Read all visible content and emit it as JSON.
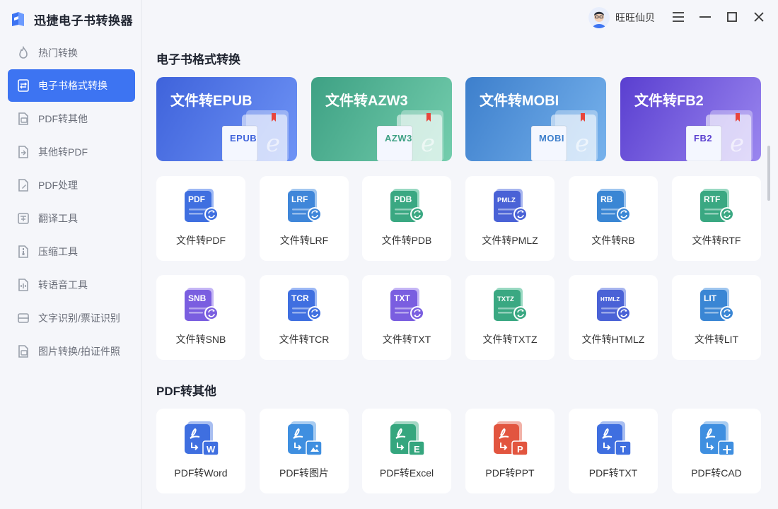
{
  "app": {
    "title": "迅捷电子书转换器"
  },
  "user": {
    "name": "旺旺仙贝"
  },
  "sidebar": {
    "items": [
      {
        "label": "热门转换",
        "icon": "fire-icon"
      },
      {
        "label": "电子书格式转换",
        "icon": "ebook-icon",
        "active": true
      },
      {
        "label": "PDF转其他",
        "icon": "pdf-convert-icon"
      },
      {
        "label": "其他转PDF",
        "icon": "to-pdf-icon"
      },
      {
        "label": "PDF处理",
        "icon": "pdf-edit-icon"
      },
      {
        "label": "翻译工具",
        "icon": "translate-icon"
      },
      {
        "label": "压缩工具",
        "icon": "compress-icon"
      },
      {
        "label": "转语音工具",
        "icon": "speech-icon"
      },
      {
        "label": "文字识别/票证识别",
        "icon": "ocr-icon"
      },
      {
        "label": "图片转换/拍证件照",
        "icon": "image-icon"
      }
    ]
  },
  "ebook_section": {
    "title": "电子书格式转换",
    "heroes": [
      {
        "label": "文件转EPUB",
        "badge": "EPUB"
      },
      {
        "label": "文件转AZW3",
        "badge": "AZW3"
      },
      {
        "label": "文件转MOBI",
        "badge": "MOBI"
      },
      {
        "label": "文件转FB2",
        "badge": "FB2"
      }
    ],
    "cards": [
      {
        "label": "文件转PDF",
        "badge": "PDF"
      },
      {
        "label": "文件转LRF",
        "badge": "LRF"
      },
      {
        "label": "文件转PDB",
        "badge": "PDB"
      },
      {
        "label": "文件转PMLZ",
        "badge": "PMLZ"
      },
      {
        "label": "文件转RB",
        "badge": "RB"
      },
      {
        "label": "文件转RTF",
        "badge": "RTF"
      },
      {
        "label": "文件转SNB",
        "badge": "SNB"
      },
      {
        "label": "文件转TCR",
        "badge": "TCR"
      },
      {
        "label": "文件转TXT",
        "badge": "TXT"
      },
      {
        "label": "文件转TXTZ",
        "badge": "TXTZ"
      },
      {
        "label": "文件转HTMLZ",
        "badge": "HTMLZ"
      },
      {
        "label": "文件转LIT",
        "badge": "LIT"
      }
    ]
  },
  "pdf_section": {
    "title": "PDF转其他",
    "cards": [
      {
        "label": "PDF转Word",
        "badge": "W"
      },
      {
        "label": "PDF转图片",
        "badge": ""
      },
      {
        "label": "PDF转Excel",
        "badge": "E"
      },
      {
        "label": "PDF转PPT",
        "badge": "P"
      },
      {
        "label": "PDF转TXT",
        "badge": "T"
      },
      {
        "label": "PDF转CAD",
        "badge": ""
      }
    ]
  },
  "colors": {
    "accent": "#3d74f2",
    "epub": "#4a74e8",
    "azw3": "#48b08e",
    "mobi": "#4a8fd6",
    "fb2": "#6a5bd8"
  }
}
